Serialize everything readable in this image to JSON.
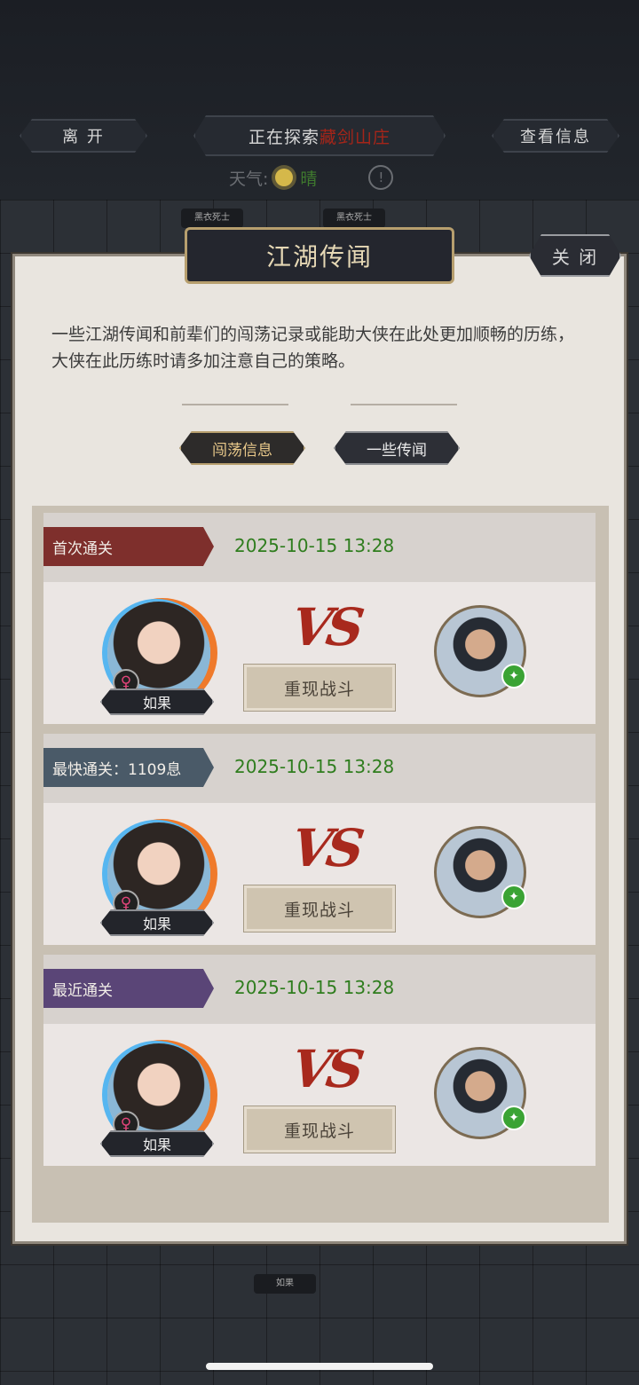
{
  "topbar": {
    "leave_label": "离 开",
    "exploring_prefix": "正在探索",
    "location": "藏剑山庄",
    "view_info_label": "查看信息",
    "weather_label": "天气:",
    "weather_value": "晴",
    "warning_icon": "!"
  },
  "map_npcs": [
    "黑衣死士",
    "黑衣死士",
    "如果"
  ],
  "dialog": {
    "title": "江湖传闻",
    "close_label": "关 闭",
    "intro": "一些江湖传闻和前辈们的闯荡记录或能助大侠在此处更加顺畅的历练，大侠在此历练时请多加注意自己的策略。",
    "tabs": [
      {
        "label": "闯荡信息",
        "active": true
      },
      {
        "label": "一些传闻",
        "active": false
      }
    ],
    "records": [
      {
        "ribbon": "首次通关",
        "ribbon_color": "#7e2f2c",
        "date": "2025-10-15 13:28",
        "hero_name": "如果",
        "vs": "VS",
        "replay_label": "重现战斗"
      },
      {
        "ribbon": "最快通关：1109息",
        "ribbon_color": "#4a5a68",
        "date": "2025-10-15 13:28",
        "hero_name": "如果",
        "vs": "VS",
        "replay_label": "重现战斗"
      },
      {
        "ribbon": "最近通关",
        "ribbon_color": "#5a4577",
        "date": "2025-10-15 13:28",
        "hero_name": "如果",
        "vs": "VS",
        "replay_label": "重现战斗"
      }
    ]
  },
  "icons": {
    "gender": "♀",
    "enemy_badge": "green-leaf-icon"
  }
}
